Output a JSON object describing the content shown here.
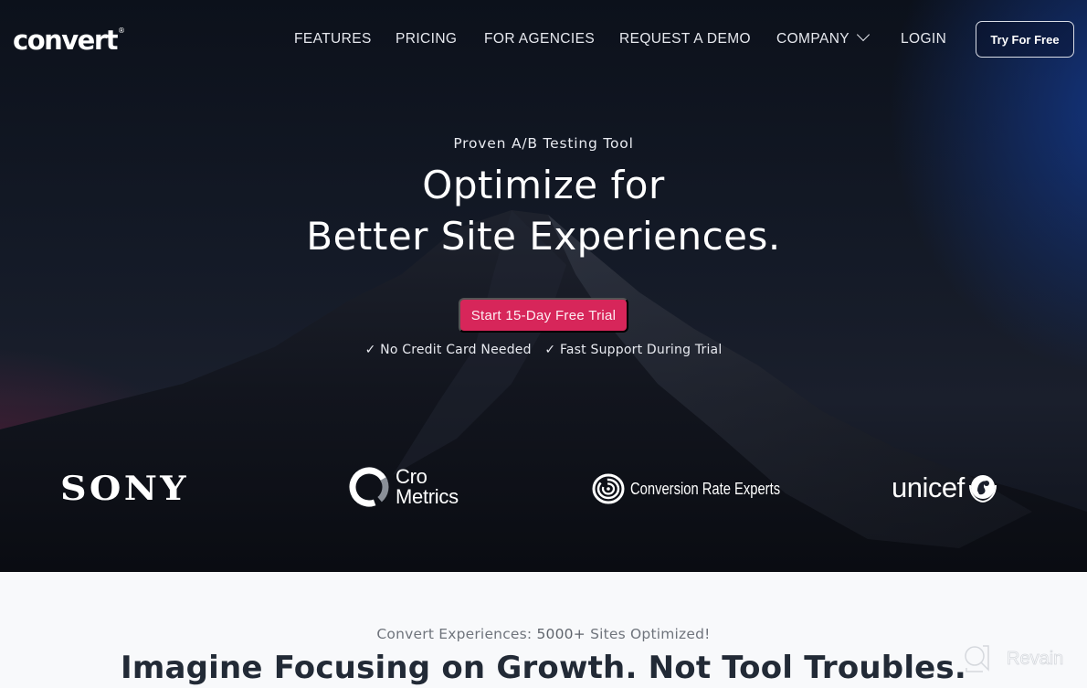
{
  "brand": {
    "logo_text_pre": "con",
    "logo_text_post": "ert",
    "logo_mark": "v",
    "registered": "®"
  },
  "nav": {
    "items": [
      {
        "label": "FEATURES"
      },
      {
        "label": "PRICING"
      },
      {
        "label": "FOR AGENCIES"
      },
      {
        "label": "REQUEST A DEMO"
      },
      {
        "label": "COMPANY",
        "icon": "chevron-down-icon"
      },
      {
        "label": "LOGIN"
      }
    ],
    "cta_label": "Try For Free"
  },
  "hero": {
    "eyebrow": "Proven A/B Testing Tool",
    "headline_line1": "Optimize for",
    "headline_line2": "Better Site Experiences.",
    "cta_label": "Start 15-Day Free Trial",
    "benefits": [
      {
        "check": "✓",
        "text": "No Credit Card Needed"
      },
      {
        "check": "✓",
        "text": "Fast Support During Trial"
      }
    ]
  },
  "customer_logos": [
    {
      "name": "SONY"
    },
    {
      "name_line1": "Cro",
      "name_line2": "Metrics"
    },
    {
      "name": "Conversion Rate Experts"
    },
    {
      "name": "unicef"
    }
  ],
  "social_proof": {
    "subtitle_pre": "Convert Experiences: ",
    "subtitle_bold": "5000+",
    "subtitle_post": " Sites Optimized!",
    "title": "Imagine Focusing on Growth. Not Tool Troubles."
  },
  "watermark": {
    "text": "Revain"
  },
  "colors": {
    "cta": "#d7265a",
    "hero_bg": "#0c111b",
    "accent_blue": "#143c96",
    "accent_magenta": "#8c1e46"
  }
}
